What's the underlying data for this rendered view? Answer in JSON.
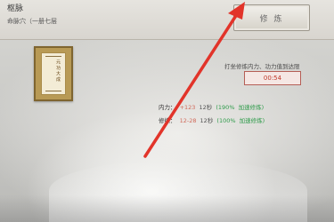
{
  "panel": {
    "title": "枢脉",
    "subtitle": "命脉穴（一册七层",
    "practice_label": "修 炼"
  },
  "scroll": {
    "title": "元 功 大 成"
  },
  "tip": "打坐修炼内力、功力值到达限",
  "timer": "00:54",
  "stats": [
    {
      "label": "内力：",
      "value": "+123",
      "rate": "12秒",
      "pct": "(190%",
      "status": "加速修炼)"
    },
    {
      "label": "修练：",
      "value": "12-28",
      "rate": "12秒",
      "pct": "(100%",
      "status": "加速修炼)"
    }
  ],
  "colors": {
    "arrow": "#e2342a",
    "timer_border": "#b55e56",
    "green": "#2e9b4a"
  }
}
